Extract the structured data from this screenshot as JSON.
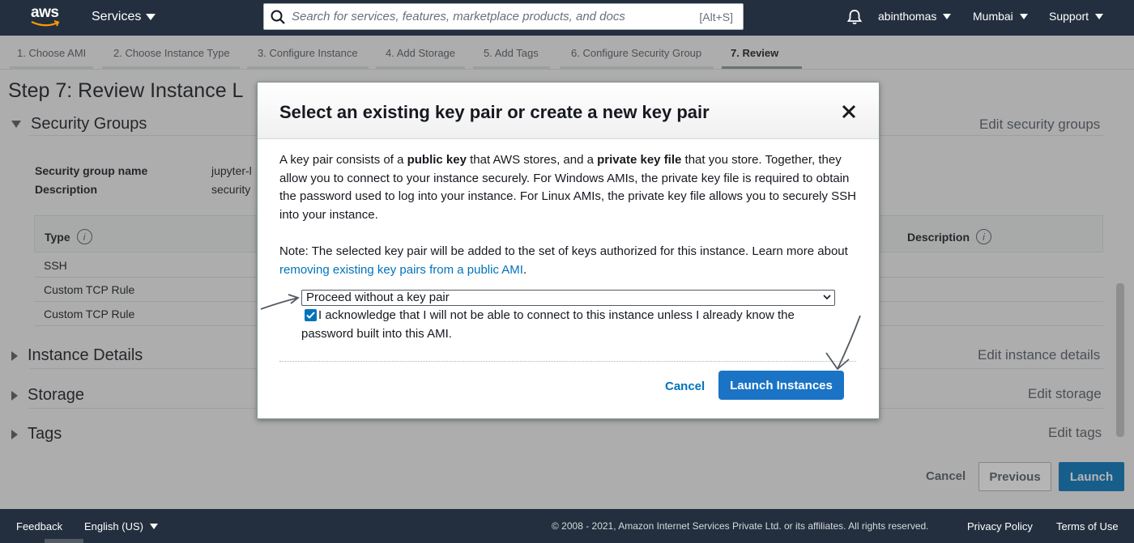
{
  "topnav": {
    "logo": "aws",
    "services_label": "Services",
    "search_placeholder": "Search for services, features, marketplace products, and docs",
    "search_shortcut": "[Alt+S]",
    "user": "abinthomas",
    "region": "Mumbai",
    "support": "Support"
  },
  "steps": [
    {
      "label": "1. Choose AMI"
    },
    {
      "label": "2. Choose Instance Type"
    },
    {
      "label": "3. Configure Instance"
    },
    {
      "label": "4. Add Storage"
    },
    {
      "label": "5. Add Tags"
    },
    {
      "label": "6. Configure Security Group"
    },
    {
      "label": "7. Review"
    }
  ],
  "page": {
    "title": "Step 7: Review Instance L",
    "security_groups": {
      "heading": "Security Groups",
      "edit": "Edit security groups",
      "name_label": "Security group name",
      "name_value": "jupyter-l",
      "desc_label": "Description",
      "desc_value": "security",
      "columns": {
        "type": "Type",
        "description": "Description"
      },
      "rows": [
        "SSH",
        "Custom TCP Rule",
        "Custom TCP Rule"
      ]
    },
    "instance_details": {
      "heading": "Instance Details",
      "edit": "Edit instance details"
    },
    "storage": {
      "heading": "Storage",
      "edit": "Edit storage"
    },
    "tags": {
      "heading": "Tags",
      "edit": "Edit tags"
    },
    "buttons": {
      "cancel": "Cancel",
      "previous": "Previous",
      "launch": "Launch"
    }
  },
  "modal": {
    "title": "Select an existing key pair or create a new key pair",
    "p1_a": "A key pair consists of a ",
    "p1_b": "public key",
    "p1_c": " that AWS stores, and a ",
    "p1_d": "private key file",
    "p1_e": " that you store. Together, they allow you to connect to your instance securely. For Windows AMIs, the private key file is required to obtain the password used to log into your instance. For Linux AMIs, the private key file allows you to securely SSH into your instance.",
    "p2_a": "Note: The selected key pair will be added to the set of keys authorized for this instance. Learn more about ",
    "p2_link": "removing existing key pairs from a public AMI",
    "p2_b": ".",
    "select_value": "Proceed without a key pair",
    "acknowledge": "I acknowledge that I will not be able to connect to this instance unless I already know the password built into this AMI.",
    "acknowledge_checked": true,
    "cancel": "Cancel",
    "launch": "Launch Instances"
  },
  "footer": {
    "feedback": "Feedback",
    "language": "English (US)",
    "copyright": "© 2008 - 2021, Amazon Internet Services Private Ltd. or its affiliates. All rights reserved.",
    "privacy": "Privacy Policy",
    "terms": "Terms of Use"
  },
  "colors": {
    "nav_bg": "#232f3e",
    "primary": "#0073bb",
    "modal_launch": "#1a73c5"
  }
}
